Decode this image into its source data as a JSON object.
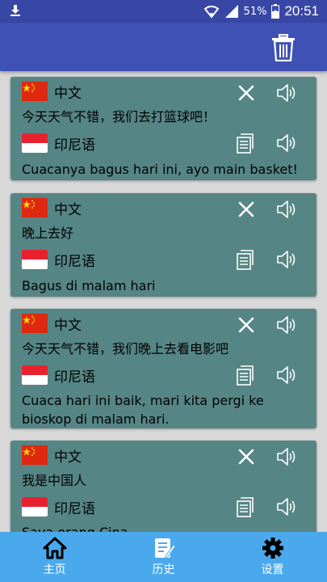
{
  "status": {
    "battery": "51%",
    "time": "20:51"
  },
  "toolbar": {
    "delete_icon": "trash-icon"
  },
  "history": [
    {
      "src_lang": "中文",
      "src_text": "今天天气不错，我们去打篮球吧！",
      "tgt_lang": "印尼语",
      "tgt_text": "Cuacanya bagus hari ini, ayo main basket!"
    },
    {
      "src_lang": "中文",
      "src_text": "晚上去好",
      "tgt_lang": "印尼语",
      "tgt_text": "Bagus di malam hari"
    },
    {
      "src_lang": "中文",
      "src_text": "今天天气不错，我们晚上去看电影吧",
      "tgt_lang": "印尼语",
      "tgt_text": "Cuaca hari ini baik, mari kita pergi ke bioskop di malam hari."
    },
    {
      "src_lang": "中文",
      "src_text": "我是中国人",
      "tgt_lang": "印尼语",
      "tgt_text": "Saya orang Cina"
    }
  ],
  "nav": {
    "home": "主页",
    "history": "历史",
    "settings": "设置"
  },
  "colors": {
    "appbar": "#3f51b5",
    "card": "#568585",
    "bottombar": "#4aa9ec"
  }
}
